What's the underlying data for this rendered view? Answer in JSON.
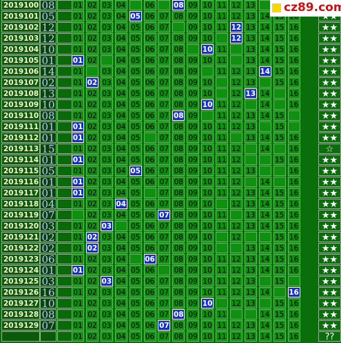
{
  "site_logo": "cz89.com",
  "prediction_label": "??",
  "rows": [
    {
      "period": "2019100",
      "drawn": "08",
      "cells": [
        "",
        "01",
        "02",
        "03",
        "04",
        "",
        "06",
        "",
        "08",
        "09",
        "10",
        "11",
        "12",
        "13",
        "",
        "",
        ""
      ],
      "hit": "08",
      "stars": "★★"
    },
    {
      "period": "2019101",
      "drawn": "05",
      "cells": [
        "",
        "01",
        "02",
        "03",
        "04",
        "05",
        "06",
        "07",
        "08",
        "09",
        "10",
        "11",
        "12",
        "13",
        "14",
        "15",
        "16"
      ],
      "hit": "05",
      "stars": "★★"
    },
    {
      "period": "2019102",
      "drawn": "12",
      "cells": [
        "",
        "01",
        "02",
        "03",
        "04",
        "05",
        "06",
        "07",
        "",
        "09",
        "10",
        "11",
        "12",
        "13",
        "14",
        "15",
        "16"
      ],
      "hit": "12",
      "stars": "★★"
    },
    {
      "period": "2019103",
      "drawn": "12",
      "cells": [
        "",
        "01",
        "02",
        "03",
        "04",
        "05",
        "06",
        "07",
        "08",
        "09",
        "10",
        "",
        "12",
        "13",
        "14",
        "15",
        "16"
      ],
      "hit": "12",
      "stars": "★★"
    },
    {
      "period": "2019104",
      "drawn": "10",
      "cells": [
        "",
        "01",
        "02",
        "03",
        "04",
        "05",
        "06",
        "07",
        "08",
        "",
        "10",
        "11",
        "",
        "13",
        "14",
        "15",
        "16"
      ],
      "hit": "10",
      "stars": "★★"
    },
    {
      "period": "2019105",
      "drawn": "01",
      "cells": [
        "",
        "01",
        "02",
        "",
        "04",
        "05",
        "06",
        "07",
        "08",
        "09",
        "10",
        "11",
        "",
        "13",
        "14",
        "15",
        "16"
      ],
      "hit": "01",
      "stars": "★★"
    },
    {
      "period": "2019106",
      "drawn": "14",
      "cells": [
        "",
        "01",
        "",
        "03",
        "04",
        "05",
        "06",
        "07",
        "08",
        "09",
        "",
        "11",
        "12",
        "13",
        "14",
        "15",
        "16"
      ],
      "hit": "14",
      "stars": "★★"
    },
    {
      "period": "2019107",
      "drawn": "02",
      "cells": [
        "",
        "01",
        "02",
        "03",
        "04",
        "05",
        "06",
        "07",
        "08",
        "09",
        "10",
        "",
        "12",
        "13",
        "",
        "15",
        "16"
      ],
      "hit": "02",
      "stars": "★★"
    },
    {
      "period": "2019108",
      "drawn": "13",
      "cells": [
        "",
        "01",
        "02",
        "03",
        "04",
        "05",
        "06",
        "07",
        "08",
        "09",
        "10",
        "",
        "12",
        "13",
        "14",
        "",
        "16"
      ],
      "hit": "13",
      "stars": "★★"
    },
    {
      "period": "2019109",
      "drawn": "10",
      "cells": [
        "",
        "01",
        "02",
        "03",
        "04",
        "05",
        "06",
        "07",
        "08",
        "09",
        "10",
        "11",
        "12",
        "",
        "14",
        "",
        "16"
      ],
      "hit": "10",
      "stars": "★★"
    },
    {
      "period": "2019110",
      "drawn": "08",
      "cells": [
        "",
        "01",
        "02",
        "03",
        "04",
        "05",
        "06",
        "07",
        "08",
        "09",
        "",
        "11",
        "12",
        "13",
        "14",
        "15",
        ""
      ],
      "hit": "08",
      "stars": "★★"
    },
    {
      "period": "2019111",
      "drawn": "01",
      "cells": [
        "",
        "01",
        "02",
        "03",
        "04",
        "05",
        "06",
        "07",
        "08",
        "09",
        "10",
        "11",
        "12",
        "13",
        "",
        "15",
        ""
      ],
      "hit": "01",
      "stars": "★★"
    },
    {
      "period": "2019112",
      "drawn": "01",
      "cells": [
        "",
        "01",
        "02",
        "03",
        "04",
        "05",
        "",
        "07",
        "08",
        "09",
        "10",
        "11",
        "",
        "13",
        "14",
        "15",
        "16"
      ],
      "hit": "01",
      "stars": "★★"
    },
    {
      "period": "2019113",
      "drawn": "15",
      "cells": [
        "",
        "01",
        "02",
        "03",
        "04",
        "05",
        "06",
        "07",
        "08",
        "09",
        "10",
        "11",
        "12",
        "",
        "14",
        "",
        "16"
      ],
      "hit": "",
      "stars": "☆"
    },
    {
      "period": "2019114",
      "drawn": "01",
      "cells": [
        "",
        "01",
        "02",
        "03",
        "04",
        "05",
        "06",
        "07",
        "08",
        "09",
        "10",
        "11",
        "12",
        "",
        "",
        "15",
        "16"
      ],
      "hit": "01",
      "stars": "★★"
    },
    {
      "period": "2019115",
      "drawn": "05",
      "cells": [
        "",
        "01",
        "02",
        "03",
        "04",
        "05",
        "06",
        "07",
        "08",
        "09",
        "10",
        "11",
        "12",
        "13",
        "",
        "",
        "16"
      ],
      "hit": "05",
      "stars": "★★"
    },
    {
      "period": "2019116",
      "drawn": "01",
      "cells": [
        "",
        "01",
        "02",
        "03",
        "04",
        "05",
        "06",
        "07",
        "08",
        "09",
        "10",
        "11",
        "12",
        "",
        "14",
        "",
        "16"
      ],
      "hit": "01",
      "stars": "★★"
    },
    {
      "period": "2019117",
      "drawn": "01",
      "cells": [
        "",
        "01",
        "02",
        "03",
        "04",
        "05",
        "",
        "07",
        "08",
        "09",
        "10",
        "11",
        "12",
        "13",
        "14",
        "15",
        "16"
      ],
      "hit": "01",
      "stars": "★★"
    },
    {
      "period": "2019118",
      "drawn": "04",
      "cells": [
        "",
        "01",
        "02",
        "03",
        "04",
        "05",
        "06",
        "07",
        "08",
        "09",
        "10",
        "",
        "12",
        "13",
        "14",
        "15",
        "16"
      ],
      "hit": "04",
      "stars": "★★"
    },
    {
      "period": "2019119",
      "drawn": "07",
      "cells": [
        "",
        "",
        "02",
        "03",
        "04",
        "05",
        "06",
        "07",
        "08",
        "09",
        "10",
        "11",
        "",
        "13",
        "14",
        "15",
        "16"
      ],
      "hit": "07",
      "stars": "★★"
    },
    {
      "period": "2019120",
      "drawn": "03",
      "cells": [
        "",
        "01",
        "02",
        "03",
        "",
        "05",
        "06",
        "07",
        "08",
        "09",
        "10",
        "11",
        "12",
        "13",
        "14",
        "15",
        "16"
      ],
      "hit": "03",
      "stars": "★★"
    },
    {
      "period": "2019121",
      "drawn": "02",
      "cells": [
        "",
        "01",
        "02",
        "03",
        "04",
        "05",
        "06",
        "07",
        "08",
        "09",
        "10",
        "",
        "12",
        "",
        "",
        "15",
        "16"
      ],
      "hit": "02",
      "stars": "★★"
    },
    {
      "period": "2019122",
      "drawn": "02",
      "cells": [
        "",
        "01",
        "02",
        "03",
        "04",
        "05",
        "06",
        "07",
        "08",
        "09",
        "10",
        "",
        "",
        "13",
        "14",
        "15",
        "16"
      ],
      "hit": "02",
      "stars": "★★"
    },
    {
      "period": "2019123",
      "drawn": "06",
      "cells": [
        "",
        "01",
        "02",
        "03",
        "04",
        "",
        "06",
        "07",
        "08",
        "09",
        "10",
        "11",
        "12",
        "13",
        "14",
        "15",
        "16"
      ],
      "hit": "06",
      "stars": "★★"
    },
    {
      "period": "2019124",
      "drawn": "01",
      "cells": [
        "",
        "01",
        "02",
        "03",
        "04",
        "05",
        "06",
        "",
        "08",
        "09",
        "10",
        "11",
        "12",
        "13",
        "14",
        "15",
        "16"
      ],
      "hit": "01",
      "stars": "★★"
    },
    {
      "period": "2019125",
      "drawn": "03",
      "cells": [
        "",
        "01",
        "02",
        "03",
        "04",
        "05",
        "06",
        "07",
        "08",
        "09",
        "10",
        "11",
        "12",
        "13",
        "",
        "15",
        ""
      ],
      "hit": "03",
      "stars": "★★"
    },
    {
      "period": "2019126",
      "drawn": "16",
      "cells": [
        "",
        "01",
        "02",
        "03",
        "04",
        "05",
        "06",
        "07",
        "08",
        "09",
        "10",
        "11",
        "12",
        "13",
        "14",
        "",
        "16"
      ],
      "hit": "16",
      "stars": "★★"
    },
    {
      "period": "2019127",
      "drawn": "10",
      "cells": [
        "",
        "01",
        "02",
        "03",
        "04",
        "05",
        "06",
        "07",
        "08",
        "09",
        "10",
        "",
        "12",
        "13",
        "",
        "15",
        "16"
      ],
      "hit": "10",
      "stars": "★★"
    },
    {
      "period": "2019128",
      "drawn": "08",
      "cells": [
        "",
        "01",
        "02",
        "03",
        "04",
        "05",
        "06",
        "07",
        "08",
        "09",
        "10",
        "11",
        "",
        "",
        "14",
        "15",
        "16"
      ],
      "hit": "08",
      "stars": "★★"
    },
    {
      "period": "2019129",
      "drawn": "07",
      "cells": [
        "",
        "01",
        "02",
        "03",
        "04",
        "05",
        "06",
        "07",
        "08",
        "09",
        "10",
        "11",
        "12",
        "13",
        "14",
        "15",
        "16"
      ],
      "hit": "07",
      "stars": "★★"
    },
    {
      "period": "",
      "drawn": "",
      "cells": [
        "",
        "01",
        "02",
        "03",
        "04",
        "05",
        "06",
        "07",
        "08",
        "09",
        "10",
        "11",
        "12",
        "13",
        "14",
        "15",
        "16"
      ],
      "hit": "",
      "stars": "??"
    }
  ]
}
